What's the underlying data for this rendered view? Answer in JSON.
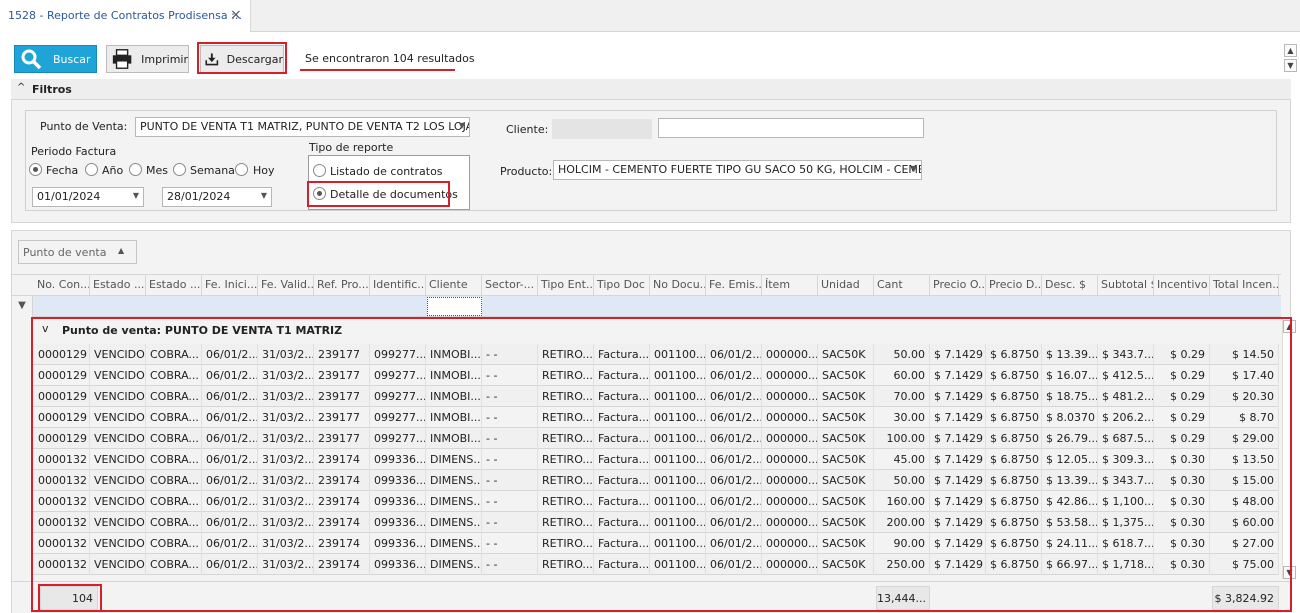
{
  "tab": {
    "title": "1528 - Reporte de Contratos Prodisensa ::.",
    "close": "×"
  },
  "toolbar": {
    "buscar": "Buscar",
    "imprimir": "Imprimir",
    "descargar": "Descargar",
    "results": "Se encontraron 104 resultados"
  },
  "filters": {
    "title": "Filtros",
    "punto_label": "Punto de Venta:",
    "punto_value": "PUNTO DE VENTA T1 MATRIZ, PUNTO DE VENTA T2  LOS LOJA...",
    "periodo_label": "Periodo Factura",
    "periodo_options": [
      "Fecha",
      "Año",
      "Mes",
      "Semana",
      "Hoy"
    ],
    "periodo_selected": "Fecha",
    "date_from": "01/01/2024",
    "date_to": "28/01/2024",
    "tipo_label": "Tipo de reporte",
    "tipo_options": [
      "Listado de contratos",
      "Detalle de documentos"
    ],
    "tipo_selected": "Detalle de documentos",
    "cliente_label": "Cliente:",
    "cliente_value": "",
    "producto_label": "Producto:",
    "producto_value": "HOLCIM  - CEMENTO FUERTE TIPO GU SACO 50 KG, HOLCIM  - CEME..."
  },
  "grid": {
    "groupby_label": "Punto de venta",
    "columns": [
      "No. Con...",
      "Estado ...",
      "Estado ...",
      "Fe. Inici...",
      "Fe. Valid...",
      "Ref. Pro...",
      "Identific...",
      "Cliente",
      "Sector-...",
      "Tipo Ent...",
      "Tipo Doc",
      "No Docu...",
      "Fe. Emis...",
      "Ítem",
      "Unidad",
      "Cant",
      "Precio O...",
      "Precio D...",
      "Desc. $",
      "Subtotal $",
      "Incentivo",
      "Total Incen..."
    ],
    "group_label": "Punto de venta: PUNTO DE VENTA T1 MATRIZ",
    "rows": [
      [
        "0000129",
        "VENCIDO",
        "COBRA...",
        "06/01/2...",
        "31/03/2...",
        "239177",
        "099277...",
        "INMOBI...",
        "- -",
        "RETIRO...",
        "Factura...",
        "001100...",
        "06/01/2...",
        "000000...",
        "SAC50K",
        "50.00",
        "$ 7.1429",
        "$ 6.8750",
        "$ 13.39...",
        "$ 343.7...",
        "$ 0.29",
        "$ 14.50"
      ],
      [
        "0000129",
        "VENCIDO",
        "COBRA...",
        "06/01/2...",
        "31/03/2...",
        "239177",
        "099277...",
        "INMOBI...",
        "- -",
        "RETIRO...",
        "Factura...",
        "001100...",
        "06/01/2...",
        "000000...",
        "SAC50K",
        "60.00",
        "$ 7.1429",
        "$ 6.8750",
        "$ 16.07...",
        "$ 412.5...",
        "$ 0.29",
        "$ 17.40"
      ],
      [
        "0000129",
        "VENCIDO",
        "COBRA...",
        "06/01/2...",
        "31/03/2...",
        "239177",
        "099277...",
        "INMOBI...",
        "- -",
        "RETIRO...",
        "Factura...",
        "001100...",
        "06/01/2...",
        "000000...",
        "SAC50K",
        "70.00",
        "$ 7.1429",
        "$ 6.8750",
        "$ 18.75...",
        "$ 481.2...",
        "$ 0.29",
        "$ 20.30"
      ],
      [
        "0000129",
        "VENCIDO",
        "COBRA...",
        "06/01/2...",
        "31/03/2...",
        "239177",
        "099277...",
        "INMOBI...",
        "- -",
        "RETIRO...",
        "Factura...",
        "001100...",
        "06/01/2...",
        "000000...",
        "SAC50K",
        "30.00",
        "$ 7.1429",
        "$ 6.8750",
        "$ 8.0370",
        "$ 206.2...",
        "$ 0.29",
        "$ 8.70"
      ],
      [
        "0000129",
        "VENCIDO",
        "COBRA...",
        "06/01/2...",
        "31/03/2...",
        "239177",
        "099277...",
        "INMOBI...",
        "- -",
        "RETIRO...",
        "Factura...",
        "001100...",
        "06/01/2...",
        "000000...",
        "SAC50K",
        "100.00",
        "$ 7.1429",
        "$ 6.8750",
        "$ 26.79...",
        "$ 687.5...",
        "$ 0.29",
        "$ 29.00"
      ],
      [
        "0000132",
        "VENCIDO",
        "COBRA...",
        "06/01/2...",
        "31/03/2...",
        "239174",
        "099336...",
        "DIMENS...",
        "- -",
        "RETIRO...",
        "Factura...",
        "001100...",
        "06/01/2...",
        "000000...",
        "SAC50K",
        "45.00",
        "$ 7.1429",
        "$ 6.8750",
        "$ 12.05...",
        "$ 309.3...",
        "$ 0.30",
        "$ 13.50"
      ],
      [
        "0000132",
        "VENCIDO",
        "COBRA...",
        "06/01/2...",
        "31/03/2...",
        "239174",
        "099336...",
        "DIMENS...",
        "- -",
        "RETIRO...",
        "Factura...",
        "001100...",
        "06/01/2...",
        "000000...",
        "SAC50K",
        "50.00",
        "$ 7.1429",
        "$ 6.8750",
        "$ 13.39...",
        "$ 343.7...",
        "$ 0.30",
        "$ 15.00"
      ],
      [
        "0000132",
        "VENCIDO",
        "COBRA...",
        "06/01/2...",
        "31/03/2...",
        "239174",
        "099336...",
        "DIMENS...",
        "- -",
        "RETIRO...",
        "Factura...",
        "001100...",
        "06/01/2...",
        "000000...",
        "SAC50K",
        "160.00",
        "$ 7.1429",
        "$ 6.8750",
        "$ 42.86...",
        "$ 1,100...",
        "$ 0.30",
        "$ 48.00"
      ],
      [
        "0000132",
        "VENCIDO",
        "COBRA...",
        "06/01/2...",
        "31/03/2...",
        "239174",
        "099336...",
        "DIMENS...",
        "- -",
        "RETIRO...",
        "Factura...",
        "001100...",
        "06/01/2...",
        "000000...",
        "SAC50K",
        "200.00",
        "$ 7.1429",
        "$ 6.8750",
        "$ 53.58...",
        "$ 1,375...",
        "$ 0.30",
        "$ 60.00"
      ],
      [
        "0000132",
        "VENCIDO",
        "COBRA...",
        "06/01/2...",
        "31/03/2...",
        "239174",
        "099336...",
        "DIMENS...",
        "- -",
        "RETIRO...",
        "Factura...",
        "001100...",
        "06/01/2...",
        "000000...",
        "SAC50K",
        "90.00",
        "$ 7.1429",
        "$ 6.8750",
        "$ 24.11...",
        "$ 618.7...",
        "$ 0.30",
        "$ 27.00"
      ],
      [
        "0000132",
        "VENCIDO",
        "COBRA...",
        "06/01/2...",
        "31/03/2...",
        "239174",
        "099336...",
        "DIMENS...",
        "- -",
        "RETIRO...",
        "Factura...",
        "001100...",
        "06/01/2...",
        "000000...",
        "SAC50K",
        "250.00",
        "$ 7.1429",
        "$ 6.8750",
        "$ 66.97...",
        "$ 1,718...",
        "$ 0.30",
        "$ 75.00"
      ]
    ],
    "footer": {
      "count": "104",
      "cant_total": "13,444...",
      "incentivo_total": "$ 3,824.92"
    }
  }
}
